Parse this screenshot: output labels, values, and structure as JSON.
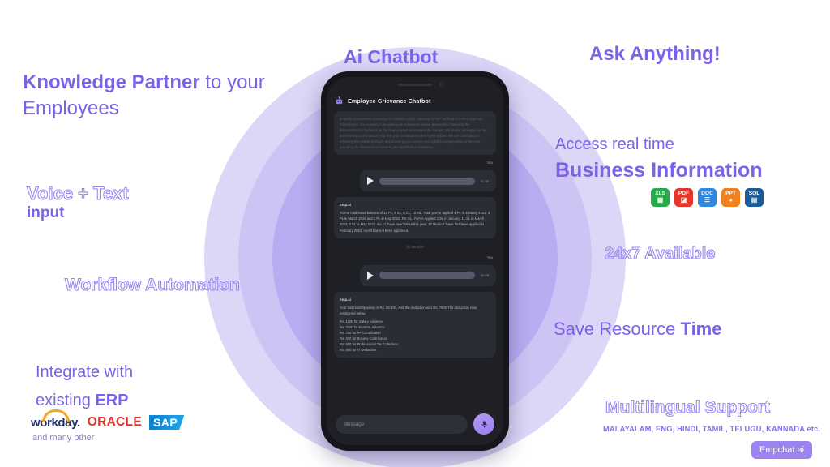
{
  "hero": {
    "ai_chatbot": "Ai Chatbot",
    "ask_anything": "Ask Anything!"
  },
  "left_features": {
    "knowledge_strong": "Knowledge Partner",
    "knowledge_light": " to your Employees",
    "voice_outline": "Voice + Text",
    "voice_solid": "input",
    "workflow": "Workflow Automation",
    "integrate_light": "Integrate with",
    "integrate_light2": "existing ",
    "integrate_strong": "ERP",
    "many_other": "and many other"
  },
  "right_features": {
    "access_light": "Access real time",
    "business_strong": "Business Information",
    "available": "24x7 Available",
    "save_light": "Save Resource ",
    "save_strong": "Time",
    "multilingual": "Multilingual Support",
    "languages": "MALAYALAM, ENG, HINDI, TAMIL, TELUGU, KANNADA etc."
  },
  "file_icons": [
    {
      "label": "XLS",
      "color": "#28a84a",
      "glyph": "▦"
    },
    {
      "label": "PDF",
      "color": "#e8352c",
      "glyph": "◪"
    },
    {
      "label": "DOC",
      "color": "#2e86de",
      "glyph": "☰"
    },
    {
      "label": "PPT",
      "color": "#f2801c",
      "glyph": "◕"
    },
    {
      "label": "SQL",
      "color": "#1d5b94",
      "glyph": "▤"
    }
  ],
  "erp_logos": {
    "workday": "workday.",
    "oracle": "ORACLE",
    "sap": "SAP"
  },
  "brand_badge": "Empchat.ai",
  "phone": {
    "app_title": "Employee Grievance Chatbot",
    "messages": [
      {
        "type": "bot-faded",
        "text": "properly documented according to company policy, requiring further verification before approval. Furthermore, the company has undergone a financial review, temporarily impacting the disbursement of bonuses as the finance team reassesses the budget. We deeply apologize for the inconvenience and assure you that your contributions are highly valued. We are committed to resolving this matter promptly and ensuring you receive your rightful compensation in the next payroll cycle. Please let us know if you need further assistance."
      },
      {
        "type": "you-tag",
        "text": "You"
      },
      {
        "type": "voice",
        "duration": "01:35"
      },
      {
        "type": "bot",
        "sender": "Emp.ai",
        "text": "You've total leave balance of 12 PL, 8 SL, 8 CL, 10 ML. Total you've applied 4 PL in January 2024, 3 PL in March 2024 and 1 PL in May 2024. For SL, You've Applied 1 SL in January, 11 SL in March 2023, 4 SL in May 2024. No CL have been taken this year. 10 Medical leave has been applied in February 2023, And it has not been approved."
      },
      {
        "type": "date",
        "text": "15 Jan 2024"
      },
      {
        "type": "you-tag",
        "text": "You"
      },
      {
        "type": "voice",
        "duration": "00:45"
      },
      {
        "type": "bot-list",
        "sender": "Emp.ai",
        "intro": "Your last monthly salary is Rs. 59,600. And the deduction was Rs. 7800 The deduction is as mentioned below",
        "lines": [
          "Rs. 1200 for Salary Advance",
          "Rs. 4100 for Festival Advance",
          "Rs. 790 for PF Contribution",
          "Rs. 410 for Society Contribution",
          "Rs. 500 for Professional Tax Collection",
          "Rs. 800 for IT Deduction"
        ]
      }
    ],
    "input_placeholder": "Message"
  },
  "colors": {
    "accent": "#7c62e8",
    "accent_light": "#9b86ef",
    "ring_outer": "#DCD6F7",
    "ring_mid": "#CDC4F5",
    "ring_inner": "#B9ADF2",
    "phone_body": "#15151a",
    "screen_bg": "#1f2025"
  }
}
